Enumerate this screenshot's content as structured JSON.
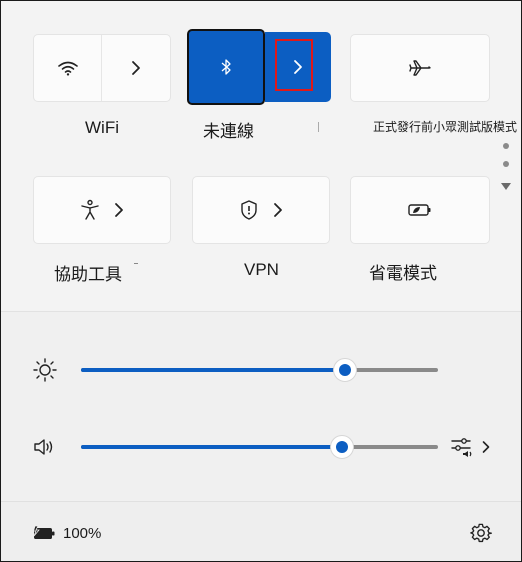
{
  "tiles": {
    "wifi": {
      "label": "WiFi",
      "icon": "wifi-icon",
      "arrow_icon": "chevron-right-icon"
    },
    "bluetooth": {
      "label": "未連線",
      "icon": "bluetooth-icon",
      "arrow_icon": "chevron-right-icon",
      "active": true
    },
    "airplane": {
      "label": "正式發行前小眾測試版模式",
      "icon": "airplane-icon"
    },
    "accessibility": {
      "label": "協助工具",
      "icon": "accessibility-icon",
      "arrow_icon": "chevron-right-icon"
    },
    "vpn": {
      "label": "VPN",
      "icon": "shield-icon",
      "arrow_icon": "chevron-right-icon"
    },
    "battery_saver": {
      "label": "省電模式",
      "icon": "battery-saver-icon"
    }
  },
  "sliders": {
    "brightness": {
      "icon": "brightness-icon",
      "level_percent": 74
    },
    "volume": {
      "icon": "speaker-icon",
      "level_percent": 73,
      "mixer_icon": "audio-mixer-icon",
      "arrow_icon": "chevron-right-icon"
    }
  },
  "footer": {
    "battery_icon": "battery-charging-icon",
    "battery_text": "100%",
    "settings_icon": "gear-icon"
  },
  "colors": {
    "accent": "#0c5ec2",
    "highlight": "#e01818",
    "panel_bg": "#f3f3f3",
    "tile_bg": "#fbfbfb"
  }
}
